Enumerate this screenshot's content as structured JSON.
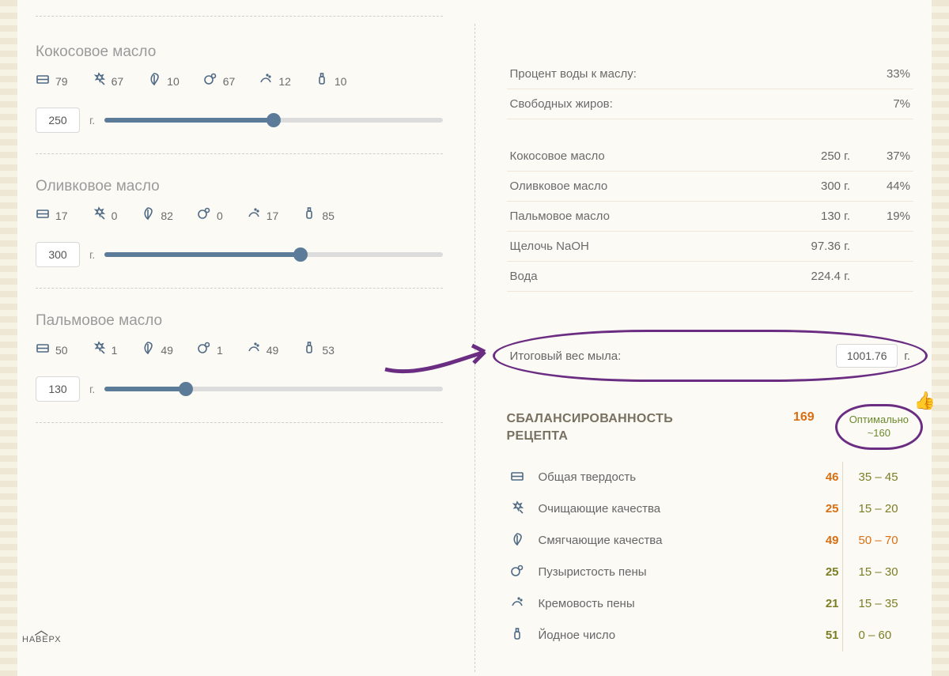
{
  "oils": [
    {
      "name": "Кокосовое масло",
      "stats": {
        "hardness": 79,
        "cleansing": 67,
        "conditioning": 10,
        "bubbly": 67,
        "creamy": 12,
        "iodine": 10
      },
      "grams": 250,
      "unit": "г.",
      "slider_pct": 50
    },
    {
      "name": "Оливковое масло",
      "stats": {
        "hardness": 17,
        "cleansing": 0,
        "conditioning": 82,
        "bubbly": 0,
        "creamy": 17,
        "iodine": 85
      },
      "grams": 300,
      "unit": "г.",
      "slider_pct": 58
    },
    {
      "name": "Пальмовое масло",
      "stats": {
        "hardness": 50,
        "cleansing": 1,
        "conditioning": 49,
        "bubbly": 1,
        "creamy": 49,
        "iodine": 53
      },
      "grams": 130,
      "unit": "г.",
      "slider_pct": 24
    }
  ],
  "params": {
    "water_to_oil": {
      "label": "Процент воды к маслу:",
      "value": "33%"
    },
    "free_fat": {
      "label": "Свободных жиров:",
      "value": "7%"
    }
  },
  "ingredients": [
    {
      "name": "Кокосовое масло",
      "grams": "250 г.",
      "pct": "37%"
    },
    {
      "name": "Оливковое масло",
      "grams": "300 г.",
      "pct": "44%"
    },
    {
      "name": "Пальмовое масло",
      "grams": "130 г.",
      "pct": "19%"
    },
    {
      "name": "Щелочь NaOH",
      "grams": "97.36 г."
    },
    {
      "name": "Вода",
      "grams": "224.4 г."
    }
  ],
  "total": {
    "label": "Итоговый вес мыла:",
    "value": "1001.76",
    "unit": "г."
  },
  "balance": {
    "title1": "СБАЛАНСИРОВАННОСТЬ",
    "title2": "РЕЦЕПТА",
    "score": 169,
    "opt_label1": "Оптимально",
    "opt_label2": "~160",
    "rows": [
      {
        "icon": "hardness",
        "name": "Общая твердость",
        "val": 46,
        "val_class": "orange",
        "range": "35 – 45",
        "range_class": "olive"
      },
      {
        "icon": "cleansing",
        "name": "Очищающие качества",
        "val": 25,
        "val_class": "orange",
        "range": "15 – 20",
        "range_class": "olive"
      },
      {
        "icon": "conditioning",
        "name": "Смягчающие качества",
        "val": 49,
        "val_class": "orange",
        "range": "50 – 70",
        "range_class": "orange"
      },
      {
        "icon": "bubbly",
        "name": "Пузыристость пены",
        "val": 25,
        "val_class": "olive",
        "range": "15 – 30",
        "range_class": "olive"
      },
      {
        "icon": "creamy",
        "name": "Кремовость пены",
        "val": 21,
        "val_class": "olive",
        "range": "15 – 35",
        "range_class": "olive"
      },
      {
        "icon": "iodine",
        "name": "Йодное число",
        "val": 51,
        "val_class": "olive",
        "range": "0 – 60",
        "range_class": "olive"
      }
    ]
  },
  "back_top": "НАВЕРХ"
}
